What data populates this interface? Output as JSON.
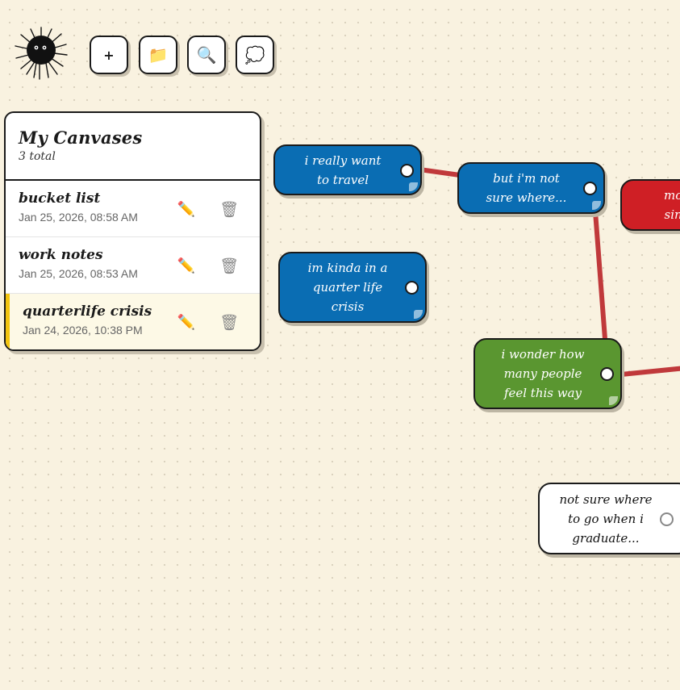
{
  "toolbar": {
    "new_icon": "+",
    "open_icon": "📁",
    "search_icon": "🔍",
    "thought_icon": "💭"
  },
  "panel": {
    "title": "My Canvases",
    "count": "3 total",
    "items": [
      {
        "name": "bucket list",
        "date": "Jan 25, 2026, 08:58 AM",
        "active": false
      },
      {
        "name": "work notes",
        "date": "Jan 25, 2026, 08:53 AM",
        "active": false
      },
      {
        "name": "quarterlife crisis",
        "date": "Jan 24, 2026, 10:38 PM",
        "active": true
      }
    ],
    "edit_icon": "✏️",
    "delete_icon": "🗑"
  },
  "notes": [
    {
      "text": "i really want\nto travel",
      "color": "#0a6db3"
    },
    {
      "text": "but i'm not\nsure where...",
      "color": "#0a6db3"
    },
    {
      "text": "mo\nsin",
      "color": "#cf1f25"
    },
    {
      "text": "im kinda in a\nquarter life\ncrisis",
      "color": "#0a6db3"
    },
    {
      "text": "i wonder how\nmany people\nfeel this way",
      "color": "#5a9630"
    },
    {
      "text": "not sure where\nto go when i\ngraduate...",
      "color": "#ffffff"
    }
  ],
  "connector_color": "#c0393b"
}
